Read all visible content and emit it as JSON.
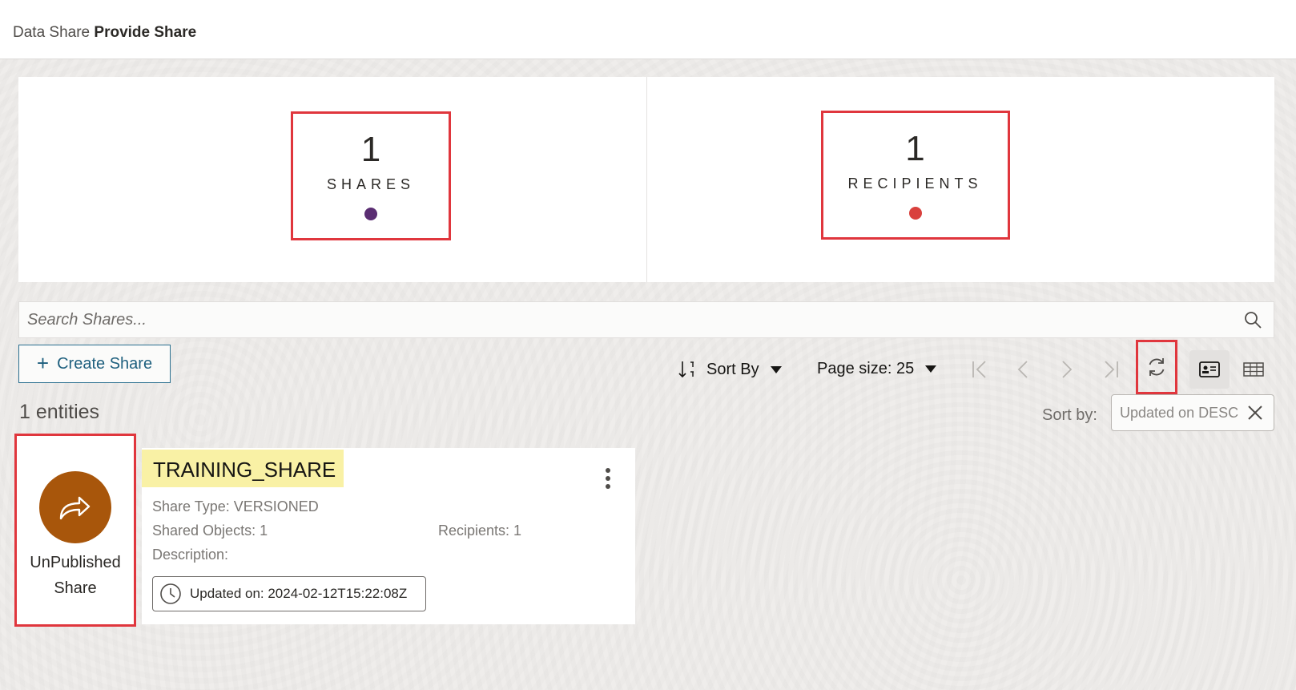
{
  "breadcrumb": {
    "parent": "Data Share",
    "current": "Provide Share"
  },
  "stats": {
    "shares": {
      "count": "1",
      "label": "SHARES",
      "color": "#5a2d72"
    },
    "recipients": {
      "count": "1",
      "label": "RECIPIENTS",
      "color": "#d9413d"
    }
  },
  "search": {
    "placeholder": "Search Shares..."
  },
  "toolbar": {
    "create_label": "Create Share",
    "sort_label": "Sort By",
    "page_size_label": "Page size: 25"
  },
  "results": {
    "entities": "1 entities",
    "sort_by_label": "Sort by:",
    "sort_value": "Updated on DESC"
  },
  "share": {
    "status": [
      "UnPublished",
      "Share"
    ],
    "status_color": "#a8560b",
    "name": "TRAINING_SHARE",
    "type": "Share Type: VERSIONED",
    "objects": "Shared Objects: 1",
    "recipients": "Recipients: 1",
    "description": "Description:",
    "updated": "Updated on: 2024-02-12T15:22:08Z"
  }
}
